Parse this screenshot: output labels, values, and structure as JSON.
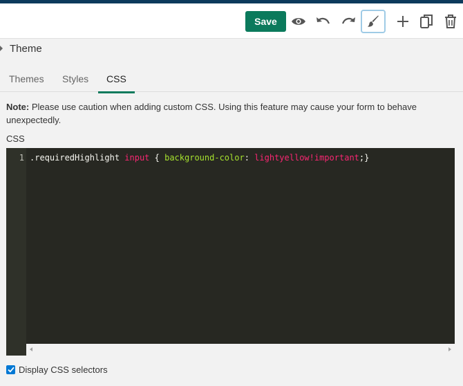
{
  "toolbar": {
    "save_label": "Save",
    "icons": [
      "eye-icon",
      "undo-icon",
      "redo-icon",
      "paintbrush-icon",
      "plus-icon",
      "copy-icon",
      "trash-icon"
    ]
  },
  "panel": {
    "title": "Theme"
  },
  "tabs": [
    {
      "label": "Themes",
      "active": false
    },
    {
      "label": "Styles",
      "active": false
    },
    {
      "label": "CSS",
      "active": true
    }
  ],
  "note": {
    "prefix": "Note:",
    "text": " Please use caution when adding custom CSS. Using this feature may cause your form to behave unexpectedly."
  },
  "editor": {
    "label": "CSS",
    "line_number": "1",
    "tokens": {
      "selector": ".requiredHighlight",
      "tag": "input",
      "brace_open": "{",
      "property": "background-color",
      "colon": ":",
      "value": "lightyellow!important",
      "end": ";}"
    }
  },
  "options": {
    "display_selectors_label": "Display CSS selectors",
    "display_selectors_checked": true
  },
  "colors": {
    "accent": "#0b7a5c",
    "editor_bg": "#272822",
    "checkbox": "#0078d4",
    "top_strip": "#0d3a5c"
  }
}
